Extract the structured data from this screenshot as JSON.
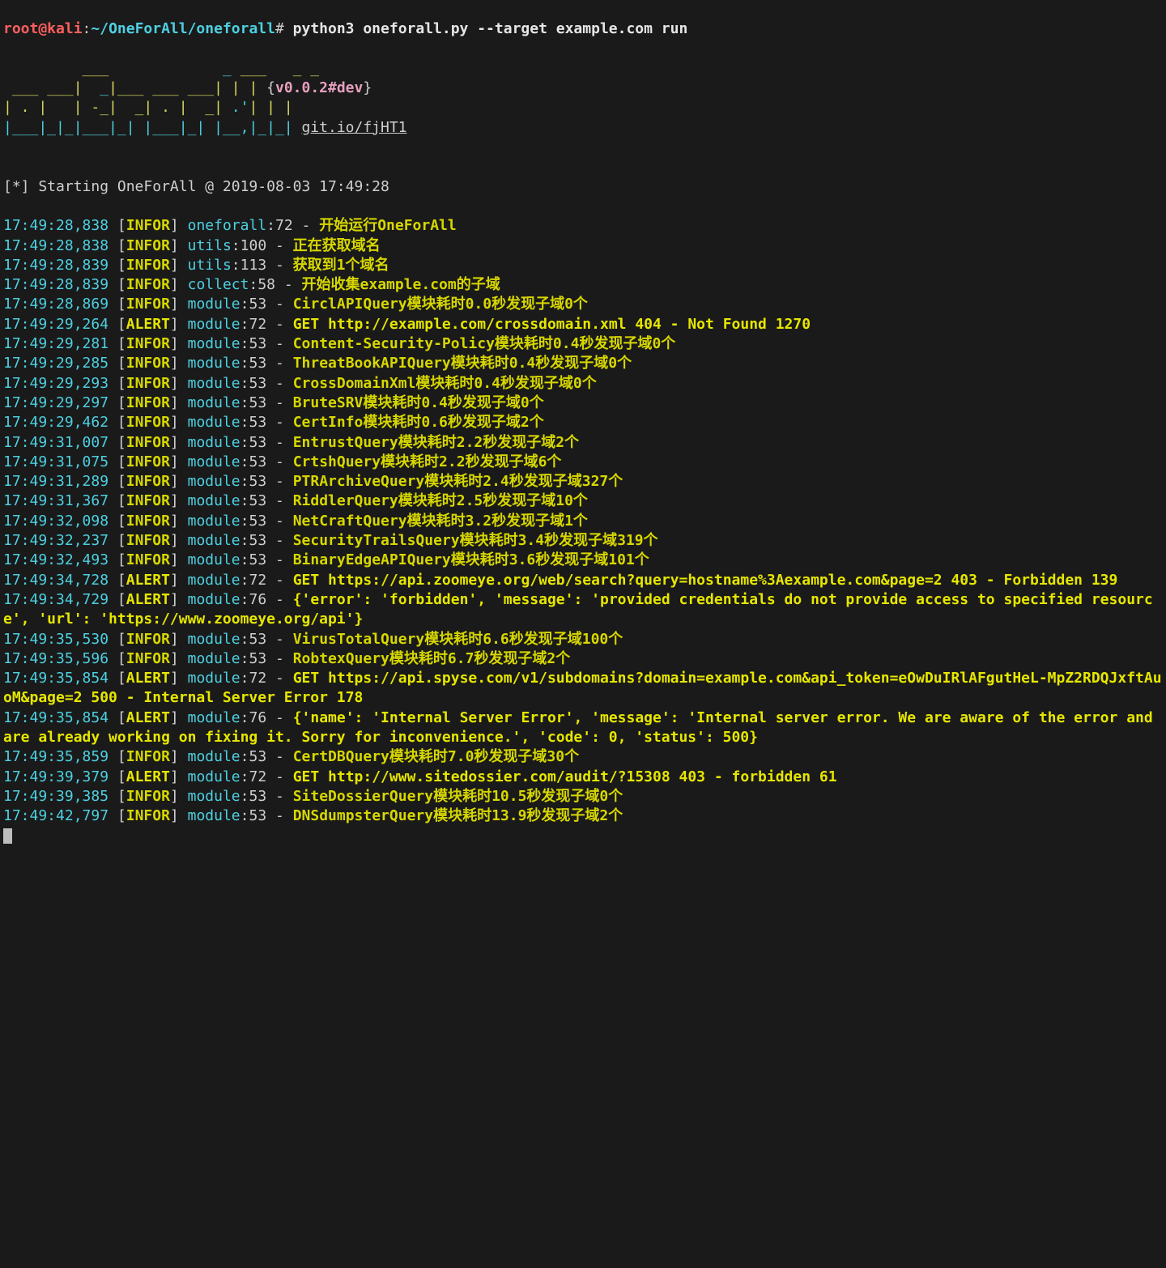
{
  "prompt": {
    "user": "root@kali",
    "sep1": ":",
    "path": "~/OneForAll/oneforall",
    "sep2": "#",
    "cmd": " python3 oneforall.py --target example.com run"
  },
  "banner": {
    "art1": "         ___             _ ___   _ _ ",
    "art2": " ___ ___|  _|___ ___ ___| | | ",
    "art3": "| . |   | -_|  _| . |  _| .'| | | ",
    "art4": "|___|_|_|___|_| |___|_| |__,|_|_| ",
    "l1y": "          ___             ___   _ _ ",
    "l1c": "       _                     _ ",
    "l2y": " ___ ___| ",
    "l2c": " _",
    "l2y2": "|___ ___ ___| | | ",
    "l3y": "| . |   | -_|  _| . |  _| ",
    "l3c": ".'",
    "l3y2": "| | | ",
    "l4c": "|___|_|_|___|_| |___|_| |__,|_|_| ",
    "version_open": "{",
    "version": "v0.0.2#dev",
    "version_close": "}",
    "link": "git.io/fjHT1"
  },
  "start": "[*] Starting OneForAll @ 2019-08-03 17:49:28",
  "logs": [
    {
      "time": "17:49:28,838",
      "level": "INFOR",
      "module": "oneforall",
      "line": "72",
      "msg": "开始运行OneForAll"
    },
    {
      "time": "17:49:28,838",
      "level": "INFOR",
      "module": "utils",
      "line": "100",
      "msg": "正在获取域名"
    },
    {
      "time": "17:49:28,839",
      "level": "INFOR",
      "module": "utils",
      "line": "113",
      "msg": "获取到1个域名"
    },
    {
      "time": "17:49:28,839",
      "level": "INFOR",
      "module": "collect",
      "line": "58",
      "msg": "开始收集example.com的子域"
    },
    {
      "time": "17:49:28,869",
      "level": "INFOR",
      "module": "module",
      "line": "53",
      "msg": "CirclAPIQuery模块耗时0.0秒发现子域0个"
    },
    {
      "time": "17:49:29,264",
      "level": "ALERT",
      "module": "module",
      "line": "72",
      "msg": "GET http://example.com/crossdomain.xml 404 - Not Found 1270"
    },
    {
      "time": "17:49:29,281",
      "level": "INFOR",
      "module": "module",
      "line": "53",
      "msg": "Content-Security-Policy模块耗时0.4秒发现子域0个"
    },
    {
      "time": "17:49:29,285",
      "level": "INFOR",
      "module": "module",
      "line": "53",
      "msg": "ThreatBookAPIQuery模块耗时0.4秒发现子域0个"
    },
    {
      "time": "17:49:29,293",
      "level": "INFOR",
      "module": "module",
      "line": "53",
      "msg": "CrossDomainXml模块耗时0.4秒发现子域0个"
    },
    {
      "time": "17:49:29,297",
      "level": "INFOR",
      "module": "module",
      "line": "53",
      "msg": "BruteSRV模块耗时0.4秒发现子域0个"
    },
    {
      "time": "17:49:29,462",
      "level": "INFOR",
      "module": "module",
      "line": "53",
      "msg": "CertInfo模块耗时0.6秒发现子域2个"
    },
    {
      "time": "17:49:31,007",
      "level": "INFOR",
      "module": "module",
      "line": "53",
      "msg": "EntrustQuery模块耗时2.2秒发现子域2个"
    },
    {
      "time": "17:49:31,075",
      "level": "INFOR",
      "module": "module",
      "line": "53",
      "msg": "CrtshQuery模块耗时2.2秒发现子域6个"
    },
    {
      "time": "17:49:31,289",
      "level": "INFOR",
      "module": "module",
      "line": "53",
      "msg": "PTRArchiveQuery模块耗时2.4秒发现子域327个"
    },
    {
      "time": "17:49:31,367",
      "level": "INFOR",
      "module": "module",
      "line": "53",
      "msg": "RiddlerQuery模块耗时2.5秒发现子域10个"
    },
    {
      "time": "17:49:32,098",
      "level": "INFOR",
      "module": "module",
      "line": "53",
      "msg": "NetCraftQuery模块耗时3.2秒发现子域1个"
    },
    {
      "time": "17:49:32,237",
      "level": "INFOR",
      "module": "module",
      "line": "53",
      "msg": "SecurityTrailsQuery模块耗时3.4秒发现子域319个"
    },
    {
      "time": "17:49:32,493",
      "level": "INFOR",
      "module": "module",
      "line": "53",
      "msg": "BinaryEdgeAPIQuery模块耗时3.6秒发现子域101个"
    },
    {
      "time": "17:49:34,728",
      "level": "ALERT",
      "module": "module",
      "line": "72",
      "msg": "GET https://api.zoomeye.org/web/search?query=hostname%3Aexample.com&page=2 403 - Forbidden 139"
    },
    {
      "time": "17:49:34,729",
      "level": "ALERT",
      "module": "module",
      "line": "76",
      "msg": "{'error': 'forbidden', 'message': 'provided credentials do not provide access to specified resource', 'url': 'https://www.zoomeye.org/api'}"
    },
    {
      "time": "17:49:35,530",
      "level": "INFOR",
      "module": "module",
      "line": "53",
      "msg": "VirusTotalQuery模块耗时6.6秒发现子域100个"
    },
    {
      "time": "17:49:35,596",
      "level": "INFOR",
      "module": "module",
      "line": "53",
      "msg": "RobtexQuery模块耗时6.7秒发现子域2个"
    },
    {
      "time": "17:49:35,854",
      "level": "ALERT",
      "module": "module",
      "line": "72",
      "msg": "GET https://api.spyse.com/v1/subdomains?domain=example.com&api_token=eOwDuIRlAFgutHeL-MpZ2RDQJxftAuoM&page=2 500 - Internal Server Error 178"
    },
    {
      "time": "17:49:35,854",
      "level": "ALERT",
      "module": "module",
      "line": "76",
      "msg": "{'name': 'Internal Server Error', 'message': 'Internal server error. We are aware of the error and are already working on fixing it. Sorry for inconvenience.', 'code': 0, 'status': 500}"
    },
    {
      "time": "17:49:35,859",
      "level": "INFOR",
      "module": "module",
      "line": "53",
      "msg": "CertDBQuery模块耗时7.0秒发现子域30个"
    },
    {
      "time": "17:49:39,379",
      "level": "ALERT",
      "module": "module",
      "line": "72",
      "msg": "GET http://www.sitedossier.com/audit/?15308 403 - forbidden 61"
    },
    {
      "time": "17:49:39,385",
      "level": "INFOR",
      "module": "module",
      "line": "53",
      "msg": "SiteDossierQuery模块耗时10.5秒发现子域0个"
    },
    {
      "time": "17:49:42,797",
      "level": "INFOR",
      "module": "module",
      "line": "53",
      "msg": "DNSdumpsterQuery模块耗时13.9秒发现子域2个"
    }
  ],
  "static": {
    "space": " ",
    "lbr": " [",
    "rbr": "] ",
    "colon": ":",
    "dash": " - "
  }
}
